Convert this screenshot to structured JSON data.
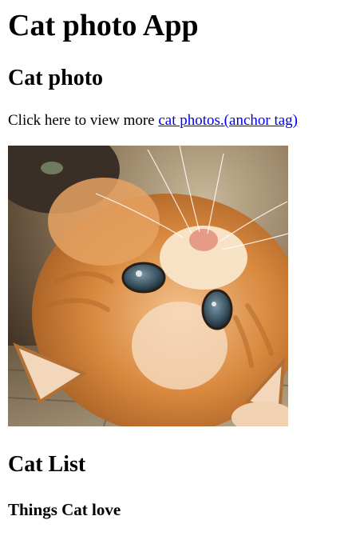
{
  "page": {
    "title": "Cat photo App"
  },
  "photo_section": {
    "heading": "Cat photo",
    "intro_text": "Click here to view more ",
    "link_text": "cat photos.(anchor tag)",
    "image_subject": "kitten-lying-upside-down"
  },
  "list_section": {
    "heading": "Cat List",
    "subheading": "Things Cat love"
  },
  "colors": {
    "link": "#0000ee",
    "text": "#000000",
    "background": "#ffffff"
  }
}
